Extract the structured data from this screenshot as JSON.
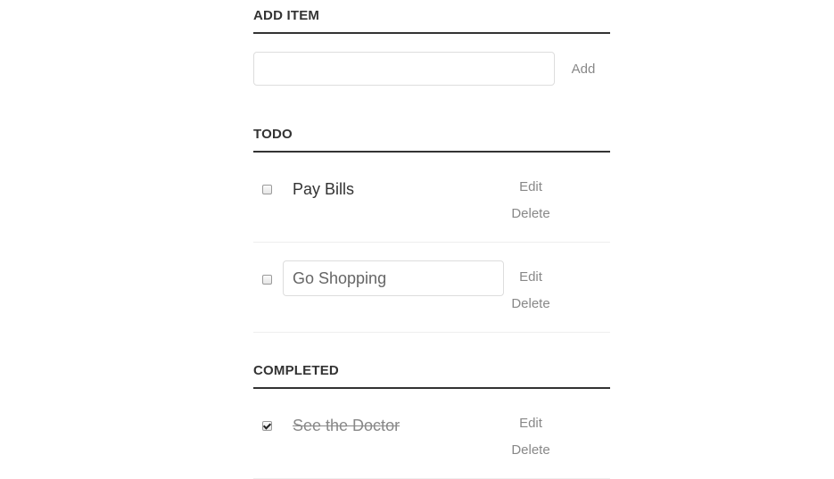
{
  "add_section": {
    "title": "ADD ITEM",
    "input_value": "",
    "input_placeholder": "",
    "add_label": "Add"
  },
  "todo_section": {
    "title": "TODO",
    "items": [
      {
        "label": "Pay Bills",
        "checked": false,
        "editing": false,
        "edit_label": "Edit",
        "delete_label": "Delete"
      },
      {
        "label": "Go Shopping",
        "checked": false,
        "editing": true,
        "edit_label": "Edit",
        "delete_label": "Delete"
      }
    ]
  },
  "completed_section": {
    "title": "COMPLETED",
    "items": [
      {
        "label": "See the Doctor",
        "checked": true,
        "editing": false,
        "edit_label": "Edit",
        "delete_label": "Delete"
      }
    ]
  }
}
